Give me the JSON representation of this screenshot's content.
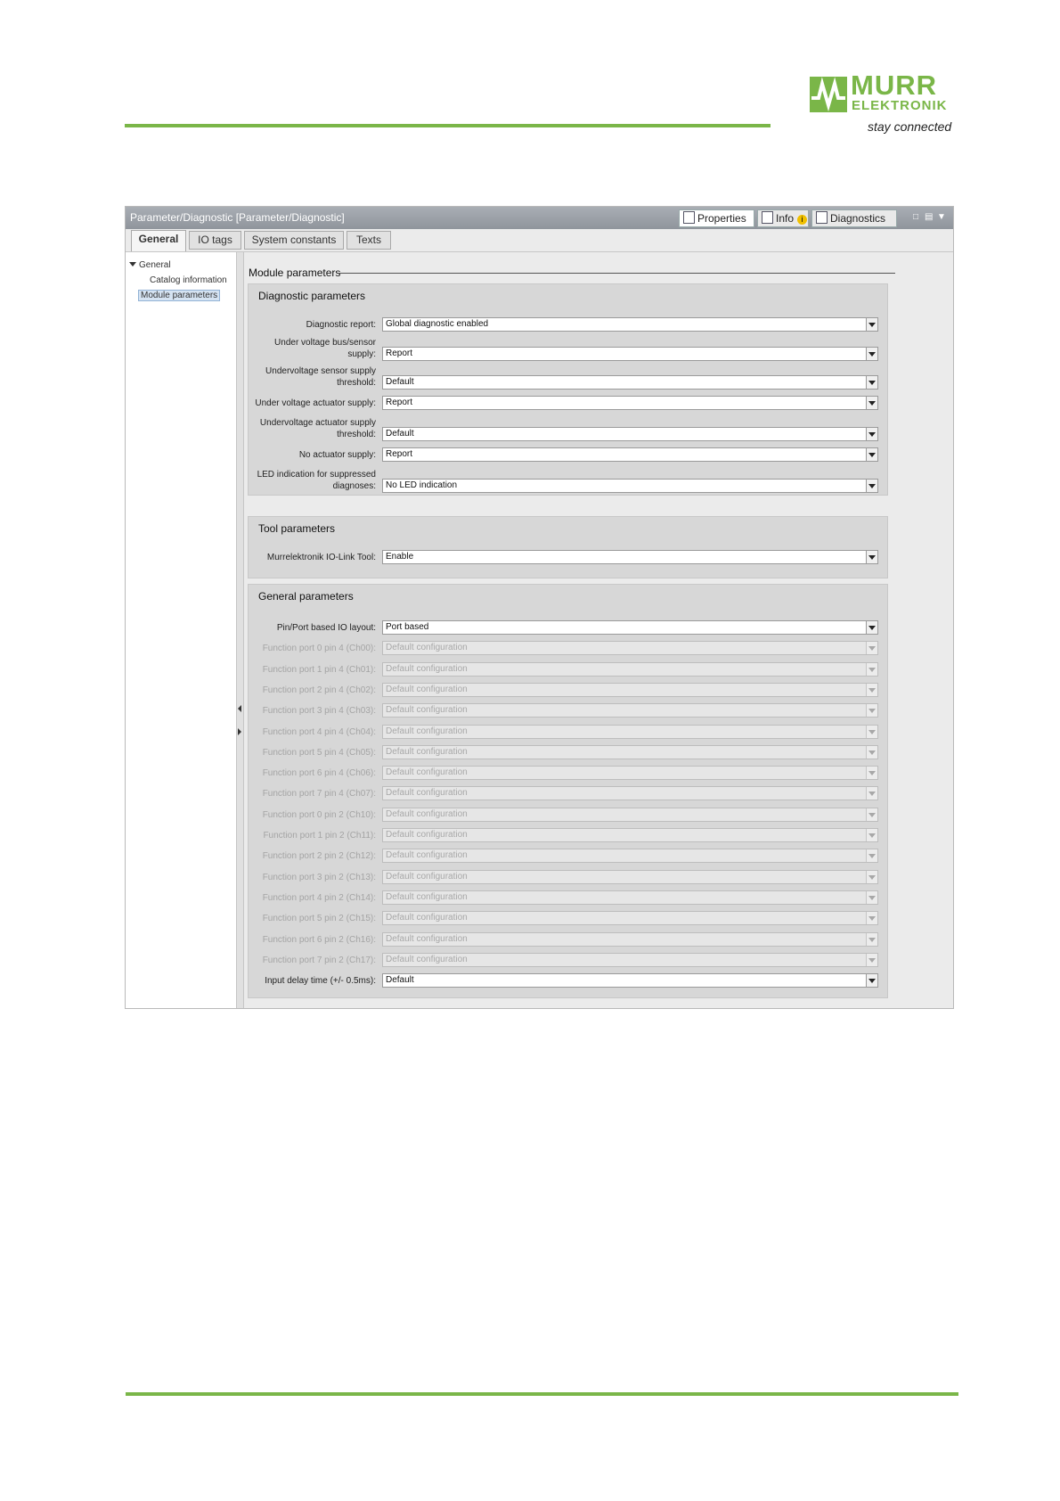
{
  "brand": {
    "name_line1": "MURR",
    "name_line2": "ELEKTRONIK",
    "slogan": "stay connected",
    "color": "#7ab648"
  },
  "window": {
    "title": "Parameter/Diagnostic [Parameter/Diagnostic]",
    "panel_tabs": [
      {
        "label": "Properties",
        "icon": "properties-icon",
        "active": true
      },
      {
        "label": "Info",
        "icon": "info-icon",
        "active": false,
        "badge": "i"
      },
      {
        "label": "Diagnostics",
        "icon": "diagnostics-icon",
        "active": false
      }
    ]
  },
  "tabs": [
    "General",
    "IO tags",
    "System constants",
    "Texts"
  ],
  "tree": {
    "root": "General",
    "children": [
      "Catalog information",
      "Module parameters"
    ],
    "selected": "Module parameters"
  },
  "main": {
    "section_title": "Module parameters",
    "diagnostic": {
      "title": "Diagnostic parameters",
      "rows": [
        {
          "label": [
            "Diagnostic report:"
          ],
          "value": "Global diagnostic enabled"
        },
        {
          "label": [
            "Under voltage bus/sensor",
            "supply:"
          ],
          "value": "Report"
        },
        {
          "label": [
            "Undervoltage sensor supply",
            "threshold:"
          ],
          "value": "Default"
        },
        {
          "label": [
            "Under voltage actuator supply:"
          ],
          "value": "Report"
        },
        {
          "label": [
            "Undervoltage actuator supply",
            "threshold:"
          ],
          "value": "Default"
        },
        {
          "label": [
            "No actuator supply:"
          ],
          "value": "Report"
        },
        {
          "label": [
            "LED indication for suppressed",
            "diagnoses:"
          ],
          "value": "No LED indication"
        }
      ]
    },
    "tool": {
      "title": "Tool parameters",
      "rows": [
        {
          "label": [
            "Murrelektronik IO-Link Tool:"
          ],
          "value": "Enable"
        }
      ]
    },
    "general": {
      "title": "General parameters",
      "rows": [
        {
          "label": "Pin/Port based IO layout:",
          "value": "Port based",
          "disabled": false
        },
        {
          "label": "Function port 0 pin 4 (Ch00):",
          "value": "Default configuration",
          "disabled": true
        },
        {
          "label": "Function port 1 pin 4 (Ch01):",
          "value": "Default configuration",
          "disabled": true
        },
        {
          "label": "Function port 2 pin 4 (Ch02):",
          "value": "Default configuration",
          "disabled": true
        },
        {
          "label": "Function port 3 pin 4 (Ch03):",
          "value": "Default configuration",
          "disabled": true
        },
        {
          "label": "Function port 4 pin 4 (Ch04):",
          "value": "Default configuration",
          "disabled": true
        },
        {
          "label": "Function port 5 pin 4 (Ch05):",
          "value": "Default configuration",
          "disabled": true
        },
        {
          "label": "Function port 6 pin 4 (Ch06):",
          "value": "Default configuration",
          "disabled": true
        },
        {
          "label": "Function port 7 pin 4 (Ch07):",
          "value": "Default configuration",
          "disabled": true
        },
        {
          "label": "Function port 0 pin 2 (Ch10):",
          "value": "Default configuration",
          "disabled": true
        },
        {
          "label": "Function port 1 pin 2 (Ch11):",
          "value": "Default configuration",
          "disabled": true
        },
        {
          "label": "Function port 2 pin 2 (Ch12):",
          "value": "Default configuration",
          "disabled": true
        },
        {
          "label": "Function port 3 pin 2 (Ch13):",
          "value": "Default configuration",
          "disabled": true
        },
        {
          "label": "Function port 4 pin 2 (Ch14):",
          "value": "Default configuration",
          "disabled": true
        },
        {
          "label": "Function port 5 pin 2 (Ch15):",
          "value": "Default configuration",
          "disabled": true
        },
        {
          "label": "Function port 6 pin 2 (Ch16):",
          "value": "Default configuration",
          "disabled": true
        },
        {
          "label": "Function port 7 pin 2 (Ch17):",
          "value": "Default configuration",
          "disabled": true
        },
        {
          "label": "Input delay time (+/- 0.5ms):",
          "value": "Default",
          "disabled": false
        }
      ]
    }
  }
}
